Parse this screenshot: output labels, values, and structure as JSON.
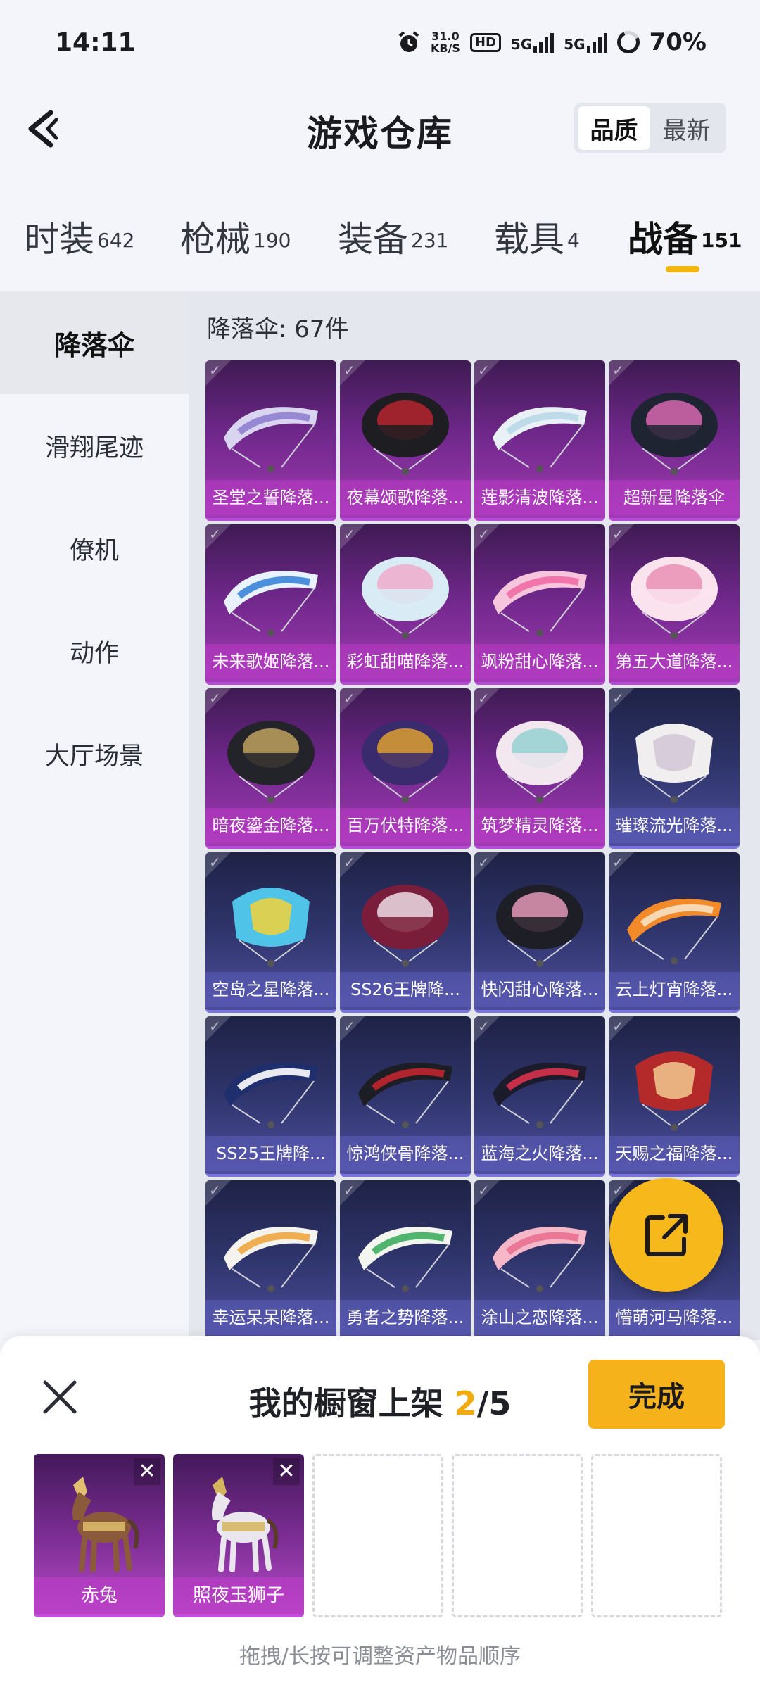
{
  "status": {
    "time": "14:11",
    "speed_value": "31.0",
    "speed_unit": "KB/S",
    "hd": "HD",
    "net1": "5G",
    "net2": "5G",
    "battery": "70%"
  },
  "header": {
    "title": "游戏仓库",
    "sort_options": [
      "品质",
      "最新"
    ],
    "sort_selected": "品质"
  },
  "tabs": [
    {
      "label": "时装",
      "count": "642"
    },
    {
      "label": "枪械",
      "count": "190"
    },
    {
      "label": "装备",
      "count": "231"
    },
    {
      "label": "载具",
      "count": "4"
    },
    {
      "label": "战备",
      "count": "151",
      "active": true
    }
  ],
  "sidebar": {
    "items": [
      "降落伞",
      "滑翔尾迹",
      "僚机",
      "动作",
      "大厅场景"
    ],
    "active": "降落伞"
  },
  "section": {
    "label": "降落伞: 67件"
  },
  "items": [
    {
      "name": "圣堂之誓降落...",
      "rarity": "purple",
      "art": "glider",
      "c1": "#d9d4f0",
      "c2": "#8f7fd0"
    },
    {
      "name": "夜幕颂歌降落...",
      "rarity": "purple",
      "art": "dome",
      "c1": "#1d1d22",
      "c2": "#c0252f"
    },
    {
      "name": "莲影清波降落...",
      "rarity": "purple",
      "art": "glider",
      "c1": "#e9f1f7",
      "c2": "#b9d8e8"
    },
    {
      "name": "超新星降落伞",
      "rarity": "purple",
      "art": "dome",
      "c1": "#1f2433",
      "c2": "#e46cb8"
    },
    {
      "name": "未来歌姬降落...",
      "rarity": "purple",
      "art": "glider",
      "c1": "#e8f3ff",
      "c2": "#3b84d9"
    },
    {
      "name": "彩虹甜喵降落...",
      "rarity": "purple",
      "art": "dome",
      "c1": "#d9ecf6",
      "c2": "#f0a8c8"
    },
    {
      "name": "飒粉甜心降落...",
      "rarity": "purple",
      "art": "glider",
      "c1": "#f7c6dc",
      "c2": "#f06aa5"
    },
    {
      "name": "第五大道降落...",
      "rarity": "purple",
      "art": "dome",
      "c1": "#fbe3ee",
      "c2": "#e98aaf"
    },
    {
      "name": "暗夜鎏金降落...",
      "rarity": "purple",
      "art": "dome",
      "c1": "#23232a",
      "c2": "#c8a862"
    },
    {
      "name": "百万伏特降落...",
      "rarity": "purple",
      "art": "dome",
      "c1": "#3a2a6e",
      "c2": "#e6a62c"
    },
    {
      "name": "筑梦精灵降落...",
      "rarity": "purple",
      "art": "dome",
      "c1": "#f3e7ef",
      "c2": "#8fd1d0"
    },
    {
      "name": "璀璨流光降落...",
      "rarity": "blue",
      "art": "square",
      "c1": "#f1eef0",
      "c2": "#d2c6d6"
    },
    {
      "name": "空岛之星降落...",
      "rarity": "blue",
      "art": "square",
      "c1": "#4fc3e8",
      "c2": "#f2d23a"
    },
    {
      "name": "SS26王牌降...",
      "rarity": "blue",
      "art": "dome",
      "c1": "#7a1d3a",
      "c2": "#f4e9ef"
    },
    {
      "name": "快闪甜心降落...",
      "rarity": "blue",
      "art": "dome",
      "c1": "#1e1e26",
      "c2": "#f0a0c0"
    },
    {
      "name": "云上灯宵降落...",
      "rarity": "blue",
      "art": "glider",
      "c1": "#f28a2a",
      "c2": "#f7e0c4"
    },
    {
      "name": "SS25王牌降...",
      "rarity": "blue",
      "art": "glider",
      "c1": "#1f2f6e",
      "c2": "#ffffff"
    },
    {
      "name": "惊鸿侠骨降落...",
      "rarity": "blue",
      "art": "glider",
      "c1": "#1d1d24",
      "c2": "#c0262f"
    },
    {
      "name": "蓝海之火降落...",
      "rarity": "blue",
      "art": "glider",
      "c1": "#1b1b2c",
      "c2": "#d8324a"
    },
    {
      "name": "天赐之福降落...",
      "rarity": "blue",
      "art": "square",
      "c1": "#b42a2a",
      "c2": "#f3c98f"
    },
    {
      "name": "幸运呆呆降落...",
      "rarity": "blue",
      "art": "glider",
      "c1": "#f5f3ee",
      "c2": "#f0a640"
    },
    {
      "name": "勇者之势降落...",
      "rarity": "blue",
      "art": "glider",
      "c1": "#f3f6ef",
      "c2": "#3fae62"
    },
    {
      "name": "涂山之恋降落...",
      "rarity": "blue",
      "art": "glider",
      "c1": "#f6b8c8",
      "c2": "#e8708f"
    },
    {
      "name": "懵萌河马降落...",
      "rarity": "blue",
      "art": "glider",
      "c1": "#b8c7e6",
      "c2": "#6f7fb0"
    }
  ],
  "fab": {
    "icon": "share-icon"
  },
  "sheet": {
    "title_prefix": "我的橱窗上架 ",
    "current": "2",
    "total": "/5",
    "done_label": "完成",
    "slots": [
      {
        "name": "赤兔",
        "filled": true,
        "body": "#8a5a3a",
        "trim": "#e0c070"
      },
      {
        "name": "照夜玉狮子",
        "filled": true,
        "body": "#e9e6ee",
        "trim": "#d4b45c"
      },
      {
        "filled": false
      },
      {
        "filled": false
      },
      {
        "filled": false
      }
    ],
    "hint": "拖拽/长按可调整资产物品顺序"
  }
}
